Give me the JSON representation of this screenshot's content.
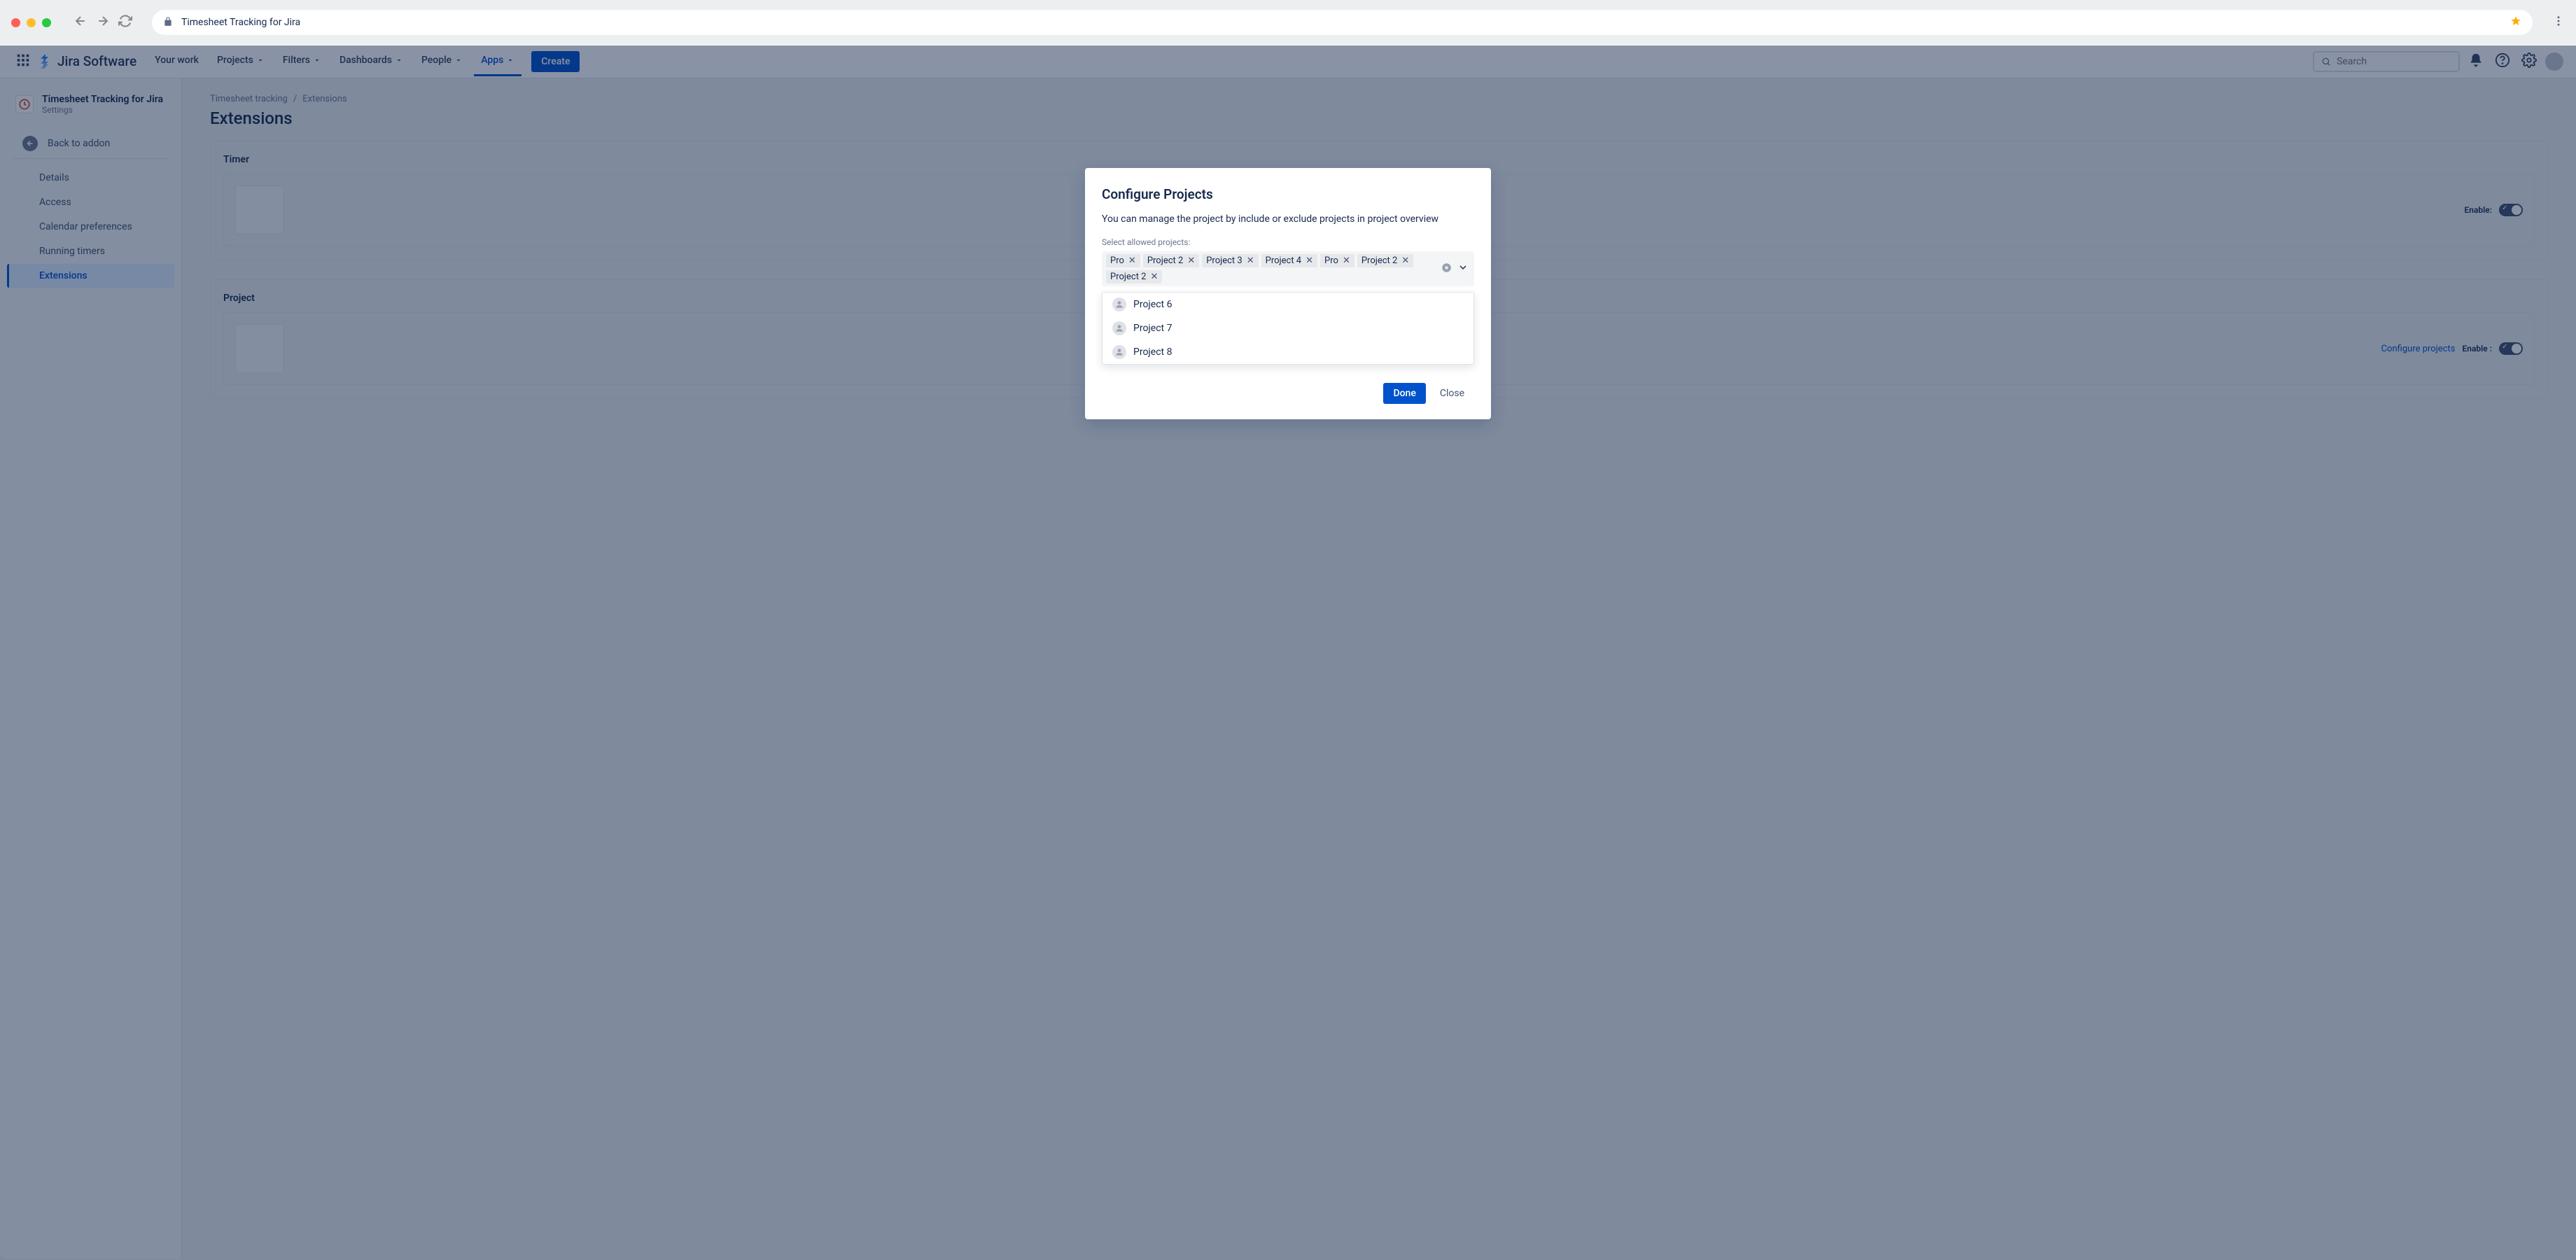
{
  "browser": {
    "url_text": "Timesheet Tracking for Jira"
  },
  "header": {
    "logo_text": "Jira Software",
    "nav": {
      "your_work": "Your work",
      "projects": "Projects",
      "filters": "Filters",
      "dashboards": "Dashboards",
      "people": "People",
      "apps": "Apps"
    },
    "create_label": "Create",
    "search_placeholder": "Search"
  },
  "sidebar": {
    "title": "Timesheet Tracking for Jira",
    "subtitle": "Settings",
    "back_label": "Back to addon",
    "items": {
      "details": "Details",
      "access": "Access",
      "calendar": "Calendar preferences",
      "timers": "Running timers",
      "extensions": "Extensions"
    }
  },
  "breadcrumbs": {
    "root": "Timesheet tracking",
    "current": "Extensions"
  },
  "page": {
    "title": "Extensions"
  },
  "cards": {
    "timer_group": "Timer",
    "project_group": "Project",
    "enable_label": "Enable :",
    "enable_label_timer": "Enable:",
    "configure_link": "Configure projects"
  },
  "modal": {
    "title": "Configure Projects",
    "description": "You can manage the project by include or exclude projects in project overview",
    "field_label": "Select allowed projects:",
    "selected": [
      "Pro",
      "Project 2",
      "Project 3",
      "Project 4",
      "Pro",
      "Project 2",
      "Project 2"
    ],
    "options": [
      "Project 6",
      "Project 7",
      "Project 8"
    ],
    "done_label": "Done",
    "close_label": "Close"
  }
}
